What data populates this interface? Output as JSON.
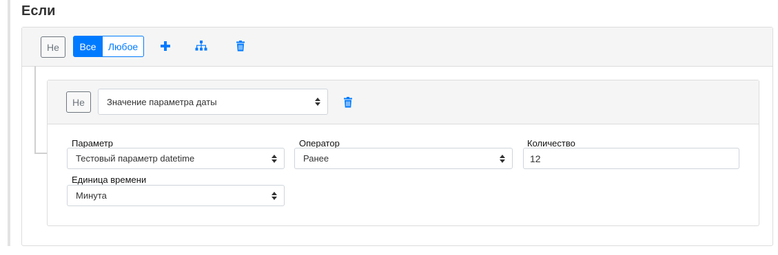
{
  "heading": "Если",
  "group": {
    "not_label": "Не",
    "all_label": "Все",
    "any_label": "Любое",
    "add_icon": "plus-icon",
    "add_group_icon": "sitemap-icon",
    "delete_icon": "trash-icon"
  },
  "rule": {
    "not_label": "Не",
    "type_select": "Значение параметра даты",
    "delete_icon": "trash-icon",
    "fields": {
      "parameter": {
        "label": "Параметр",
        "value": "Тестовый параметр datetime"
      },
      "operator": {
        "label": "Оператор",
        "value": "Ранее"
      },
      "quantity": {
        "label": "Количество",
        "value": "12"
      },
      "time_unit": {
        "label": "Единица времени",
        "value": "Минута"
      }
    }
  },
  "colors": {
    "primary": "#007bff",
    "header_bg": "#f5f5f5",
    "border": "#dcdcdc"
  }
}
